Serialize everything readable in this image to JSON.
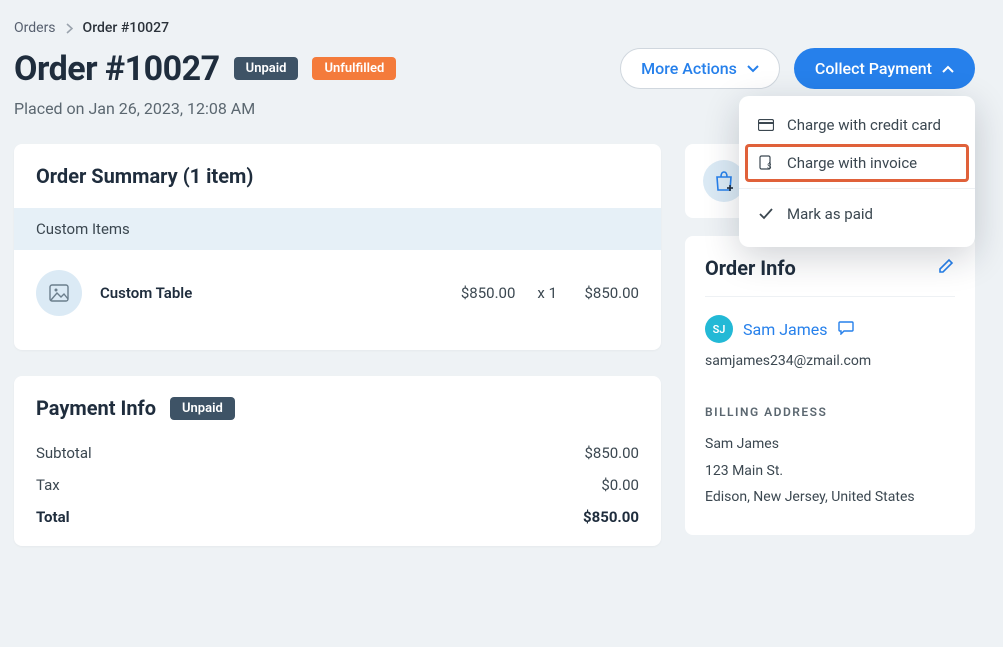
{
  "breadcrumb": {
    "root": "Orders",
    "current": "Order #10027"
  },
  "header": {
    "title": "Order #10027",
    "badges": {
      "payment": "Unpaid",
      "fulfillment": "Unfulfilled"
    },
    "placed": "Placed on Jan 26, 2023, 12:08 AM"
  },
  "actions": {
    "more": "More Actions",
    "collect": "Collect Payment"
  },
  "dropdown": {
    "credit": "Charge with credit card",
    "invoice": "Charge with invoice",
    "paid": "Mark as paid"
  },
  "summary": {
    "title": "Order Summary (1 item)",
    "section": "Custom Items",
    "item": {
      "name": "Custom Table",
      "price": "$850.00",
      "qty": "x 1",
      "total": "$850.00"
    }
  },
  "payment": {
    "title": "Payment Info",
    "badge": "Unpaid",
    "rows": {
      "subtotal_l": "Subtotal",
      "subtotal_v": "$850.00",
      "tax_l": "Tax",
      "tax_v": "$0.00",
      "total_l": "Total",
      "total_v": "$850.00"
    }
  },
  "info": {
    "title": "Order Info",
    "avatar": "SJ",
    "name": "Sam James",
    "email": "samjames234@zmail.com",
    "billing_label": "BILLING ADDRESS",
    "addr1": "Sam James",
    "addr2": "123 Main St.",
    "addr3": "Edison, New Jersey, United States"
  }
}
